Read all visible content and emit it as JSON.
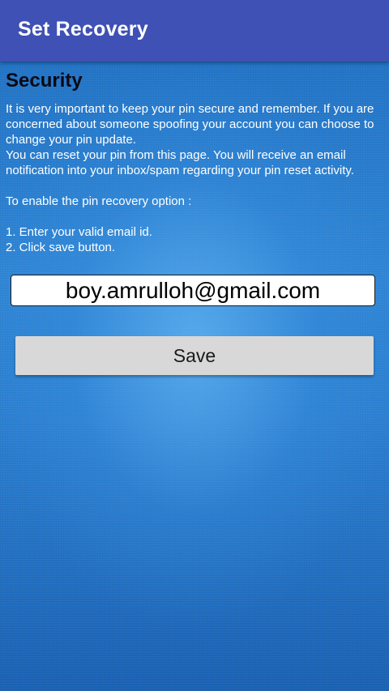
{
  "appbar": {
    "title": "Set Recovery",
    "color": "#3f51b5"
  },
  "content": {
    "section_title": "Security",
    "paragraph_1": "It is very important to keep your pin secure and remember. If you are concerned about someone spoofing your account you can choose to change your pin update.",
    "paragraph_2": " You can reset your pin from this page. You will receive an email notification into your inbox/spam regarding your pin reset activity.",
    "enable_intro": "To enable the pin recovery option :",
    "step_1": "1. Enter your valid email id.",
    "step_2": "2. Click save button."
  },
  "form": {
    "email_value": "boy.amrulloh@gmail.com",
    "save_label": "Save"
  },
  "colors": {
    "background": "#2a7fd0",
    "button": "#d8d8d8"
  }
}
